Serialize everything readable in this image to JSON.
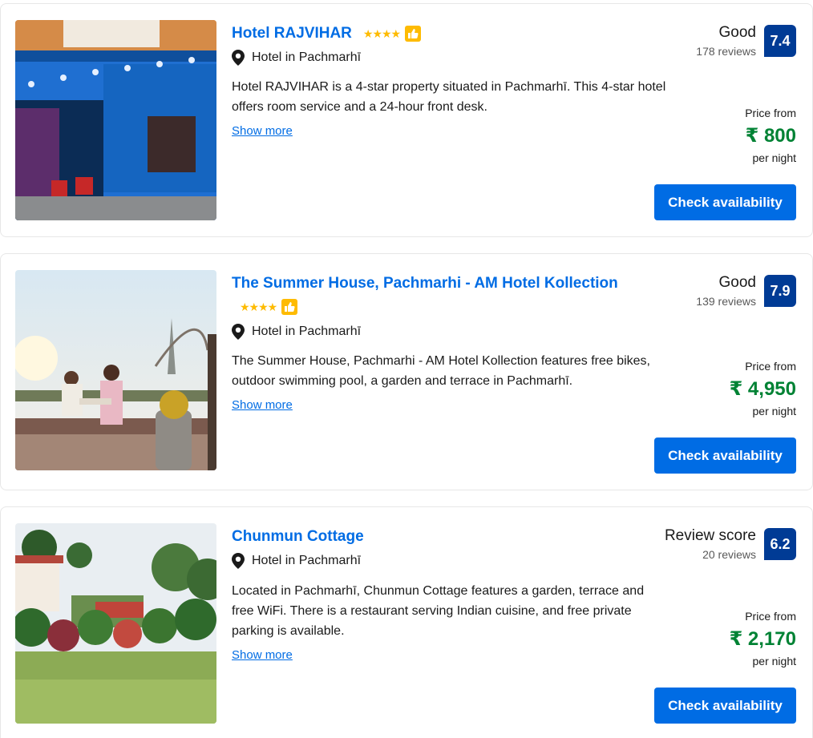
{
  "hotels": [
    {
      "name": "Hotel RAJVIHAR",
      "stars": "★★★★",
      "location": "Hotel in Pachmarhī",
      "description": "Hotel RAJVIHAR is a 4-star property situated in Pachmarhī. This 4-star hotel offers room service and a 24-hour front desk.",
      "show_more": "Show more",
      "rating_word": "Good",
      "review_count": "178 reviews",
      "score": "7.4",
      "price_from_label": "Price from",
      "price": "₹ 800",
      "per_night": "per night",
      "cta": "Check availability"
    },
    {
      "name": "The Summer House, Pachmarhi - AM Hotel Kollection",
      "stars": "★★★★",
      "location": "Hotel in Pachmarhī",
      "description": "The Summer House, Pachmarhi - AM Hotel Kollection features free bikes, outdoor swimming pool, a garden and terrace in Pachmarhī.",
      "show_more": "Show more",
      "rating_word": "Good",
      "review_count": "139 reviews",
      "score": "7.9",
      "price_from_label": "Price from",
      "price": "₹ 4,950",
      "per_night": "per night",
      "cta": "Check availability"
    },
    {
      "name": "Chunmun Cottage",
      "location": "Hotel in Pachmarhī",
      "description": "Located in Pachmarhī, Chunmun Cottage features a garden, terrace and free WiFi. There is a restaurant serving Indian cuisine, and free private parking is available.",
      "show_more": "Show more",
      "rating_word": "Review score",
      "review_count": "20 reviews",
      "score": "6.2",
      "price_from_label": "Price from",
      "price": "₹ 2,170",
      "per_night": "per night",
      "cta": "Check availability"
    }
  ],
  "colors": {
    "link": "#006ce4",
    "score_badge": "#003b95",
    "price": "#008234",
    "star": "#febb02",
    "button": "#006ce4"
  },
  "icons": {
    "location": "map-pin-icon",
    "preferred": "thumbs-up-icon"
  }
}
